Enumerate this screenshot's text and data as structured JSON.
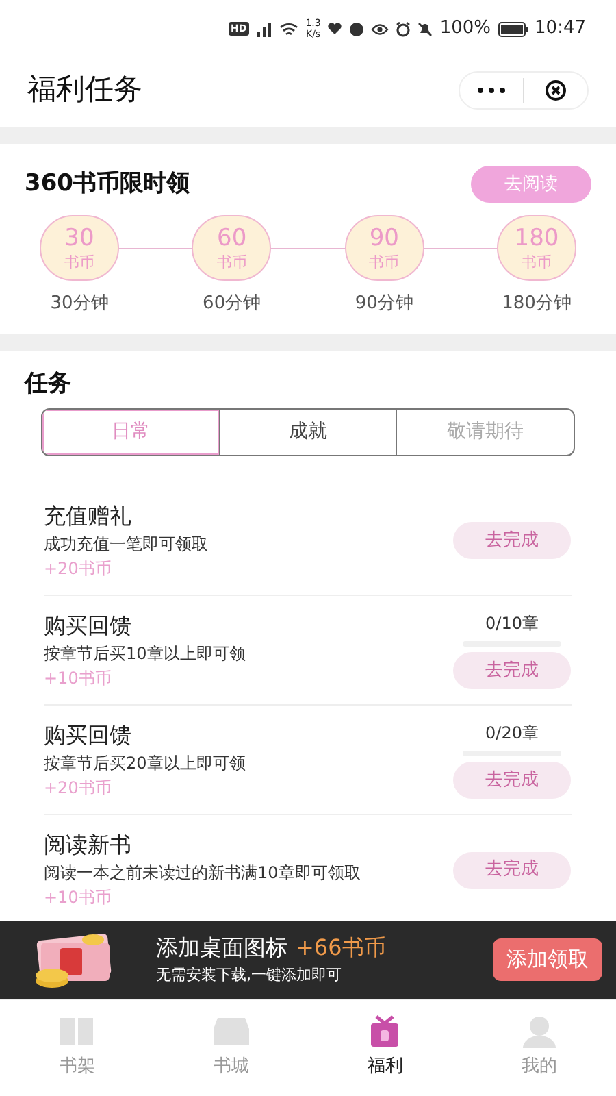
{
  "status_bar": {
    "badge": "HD",
    "speed": "1.3",
    "speed_unit": "K/s",
    "battery": "100%",
    "time": "10:47"
  },
  "header": {
    "title": "福利任务"
  },
  "reading_reward": {
    "title": "360书币限时领",
    "button": "去阅读",
    "milestones": [
      {
        "amount": "30",
        "unit": "书币",
        "time": "30分钟"
      },
      {
        "amount": "60",
        "unit": "书币",
        "time": "60分钟"
      },
      {
        "amount": "90",
        "unit": "书币",
        "time": "90分钟"
      },
      {
        "amount": "180",
        "unit": "书币",
        "time": "180分钟"
      }
    ]
  },
  "tasks": {
    "title": "任务",
    "tabs": [
      {
        "label": "日常",
        "selected": true,
        "disabled": false
      },
      {
        "label": "成就",
        "selected": false,
        "disabled": false
      },
      {
        "label": "敬请期待",
        "selected": false,
        "disabled": true
      }
    ],
    "items": [
      {
        "title": "充值赠礼",
        "description": "成功充值一笔即可领取",
        "reward": "+20书币",
        "button": "去完成"
      },
      {
        "title": "购买回馈",
        "description": "按章节后买10章以上即可领",
        "reward": "+10书币",
        "progress": "0/10章",
        "button": "去完成"
      },
      {
        "title": "购买回馈",
        "description": "按章节后买20章以上即可领",
        "reward": "+20书币",
        "progress": "0/20章",
        "button": "去完成"
      },
      {
        "title": "阅读新书",
        "description": "阅读一本之前未读过的新书满10章即可领取",
        "reward": "+10书币",
        "button": "去完成"
      }
    ]
  },
  "banner": {
    "title": "添加桌面图标",
    "bonus": "+66书币",
    "subtitle": "无需安装下载,一键添加即可",
    "button": "添加领取"
  },
  "bottom_nav": [
    {
      "label": "书架",
      "selected": false
    },
    {
      "label": "书城",
      "selected": false
    },
    {
      "label": "福利",
      "selected": true
    },
    {
      "label": "我的",
      "selected": false
    }
  ]
}
